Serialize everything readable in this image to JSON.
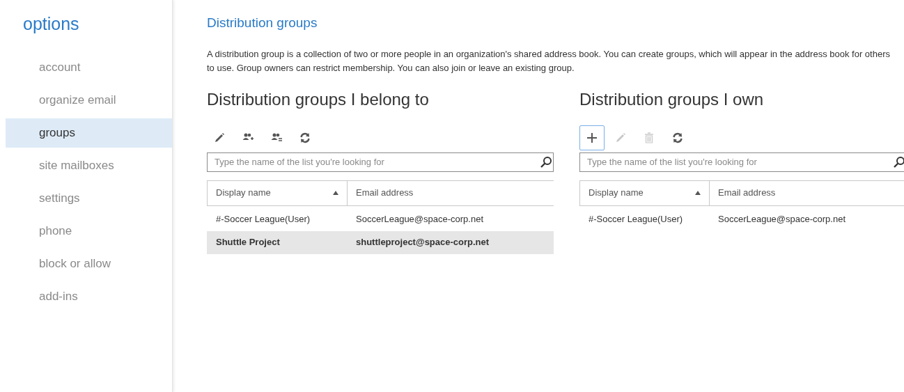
{
  "sidebar": {
    "title": "options",
    "items": [
      {
        "label": "account",
        "selected": false
      },
      {
        "label": "organize email",
        "selected": false
      },
      {
        "label": "groups",
        "selected": true
      },
      {
        "label": "site mailboxes",
        "selected": false
      },
      {
        "label": "settings",
        "selected": false
      },
      {
        "label": "phone",
        "selected": false
      },
      {
        "label": "block or allow",
        "selected": false
      },
      {
        "label": "add-ins",
        "selected": false
      }
    ]
  },
  "page": {
    "title": "Distribution groups",
    "description": "A distribution group is a collection of two or more people in an organization's shared address book. You can create groups, which will appear in the address book for others to use. Group owners can restrict membership. You can also join or leave an existing group."
  },
  "panels": [
    {
      "heading": "Distribution groups I belong to",
      "toolbar": [
        {
          "kind": "edit",
          "disabled": false,
          "focused": false
        },
        {
          "kind": "join",
          "disabled": false,
          "focused": false
        },
        {
          "kind": "leave",
          "disabled": false,
          "focused": false
        },
        {
          "kind": "refresh",
          "disabled": false,
          "focused": false
        }
      ],
      "search": {
        "placeholder": "Type the name of the list you're looking for"
      },
      "columns": [
        {
          "label": "Display name",
          "sorted": true
        },
        {
          "label": "Email address",
          "sorted": false
        }
      ],
      "rows": [
        {
          "name": "#-Soccer League(User)",
          "email": "SoccerLeague@space-corp.net",
          "selected": false
        },
        {
          "name": "Shuttle Project",
          "email": "shuttleproject@space-corp.net",
          "selected": true
        }
      ]
    },
    {
      "heading": "Distribution groups I own",
      "toolbar": [
        {
          "kind": "add",
          "disabled": false,
          "focused": true
        },
        {
          "kind": "edit",
          "disabled": true,
          "focused": false
        },
        {
          "kind": "delete",
          "disabled": true,
          "focused": false
        },
        {
          "kind": "refresh",
          "disabled": false,
          "focused": false
        }
      ],
      "search": {
        "placeholder": "Type the name of the list you're looking for"
      },
      "columns": [
        {
          "label": "Display name",
          "sorted": true
        },
        {
          "label": "Email address",
          "sorted": false
        }
      ],
      "rows": [
        {
          "name": "#-Soccer League(User)",
          "email": "SoccerLeague@space-corp.net",
          "selected": false
        }
      ]
    }
  ]
}
